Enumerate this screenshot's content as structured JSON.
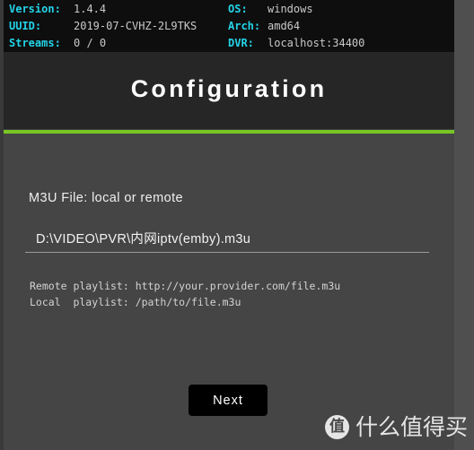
{
  "info_bar": {
    "rows": [
      {
        "left_label": "Version:",
        "left_value": "1.4.4",
        "right_label": "OS:",
        "right_value": "windows"
      },
      {
        "left_label": "UUID:",
        "left_value": "2019-07-CVHZ-2L9TKS",
        "right_label": "Arch:",
        "right_value": "amd64"
      },
      {
        "left_label": "Streams:",
        "left_value": "0 / 0",
        "right_label": "DVR:",
        "right_value": "localhost:34400"
      }
    ]
  },
  "header": {
    "title": "Configuration"
  },
  "form": {
    "field_label": "M3U File: local or remote",
    "input_value": "D:\\VIDEO\\PVR\\内网iptv(emby).m3u",
    "input_placeholder": "http://your.provider.com/file.m3u",
    "hint_remote": "Remote playlist: http://your.provider.com/file.m3u",
    "hint_local": "Local  playlist: /path/to/file.m3u",
    "next_label": "Next"
  },
  "watermark": {
    "badge": "值",
    "text": "什么值得买"
  },
  "colors": {
    "accent_green": "#77c725",
    "label_cyan": "#24d3e8",
    "info_bar_bg": "#0e0e0e",
    "title_bg": "#262626",
    "body_bg": "#454545",
    "button_bg": "#000000"
  }
}
